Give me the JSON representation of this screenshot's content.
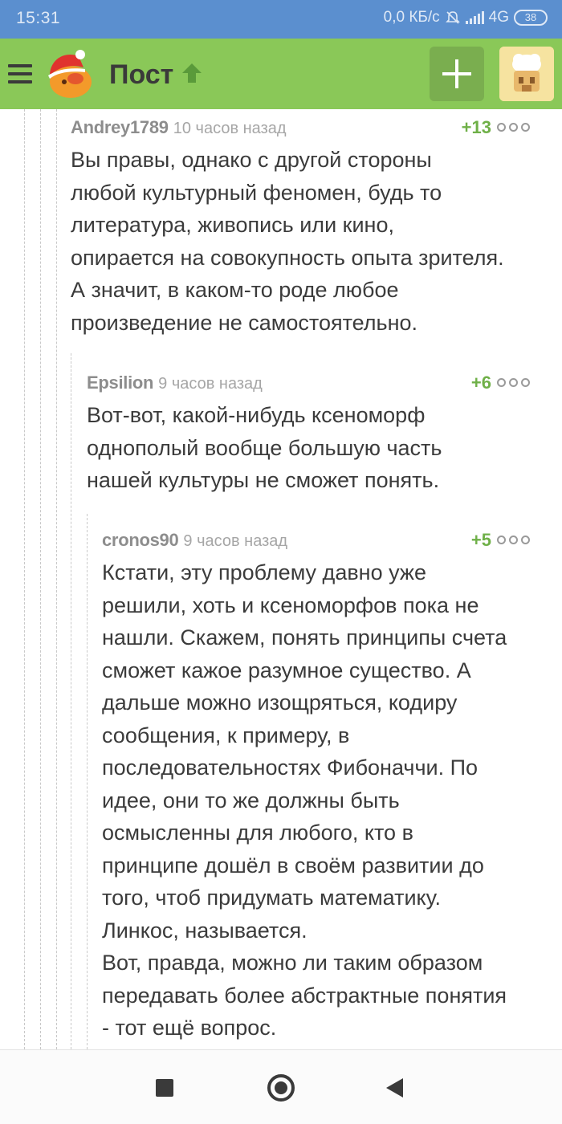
{
  "status_bar": {
    "time": "15:31",
    "network_speed": "0,0 КБ/с",
    "mute_icon": "bell-off-icon",
    "signal_icon": "signal-icon",
    "network_type": "4G",
    "battery": "38"
  },
  "toolbar": {
    "menu_icon": "hamburger-menu-icon",
    "logo_icon": "pikabu-logo-icon",
    "title": "Пост",
    "title_icon": "arrow-up-icon",
    "add_icon": "plus-icon",
    "avatar_icon": "user-avatar-icon",
    "colors": {
      "bar": "#8ac858",
      "title": "#3a3a3a",
      "status_bar": "#5b8fcf"
    }
  },
  "comments": [
    {
      "author": "Andrey1789",
      "time": "10 часов назад",
      "rating": "+13",
      "text": "Вы правы, однако с другой стороны\nлюбой культурный феномен, будь то\nлитература, живопись или кино,\nопирается на совокупность опыта зрителя.\nА значит, в каком-то роде любое\nпроизведение не самостоятельно."
    },
    {
      "author": "Epsilion",
      "time": "9 часов назад",
      "rating": "+6",
      "text": "Вот-вот, какой-нибудь ксеноморф\nоднополый вообще большую часть\nнашей культуры не сможет понять."
    },
    {
      "author": "cronos90",
      "time": "9 часов назад",
      "rating": "+5",
      "text": "Кстати, эту проблему давно уже\nрешили, хоть и ксеноморфов пока не\nнашли. Скажем, понять принципы счета\nсможет кажое разумное существо. А\nдальше можно изощряться, кодиру\nсообщения, к примеру, в\nпоследовательностях Фибоначчи. По\nидее, они то же должны быть\nосмысленны для любого, кто в\nпринципе дошёл в своём развитии до\nтого, чтоб придумать математику.\nЛинкос, называется.\nВот, правда, можно ли таким образом\nпередавать более абстрактные понятия\n- тот ещё вопрос."
    }
  ],
  "nav_bar": {
    "recents_icon": "square-recents-icon",
    "home_icon": "circle-home-icon",
    "back_icon": "triangle-back-icon"
  }
}
